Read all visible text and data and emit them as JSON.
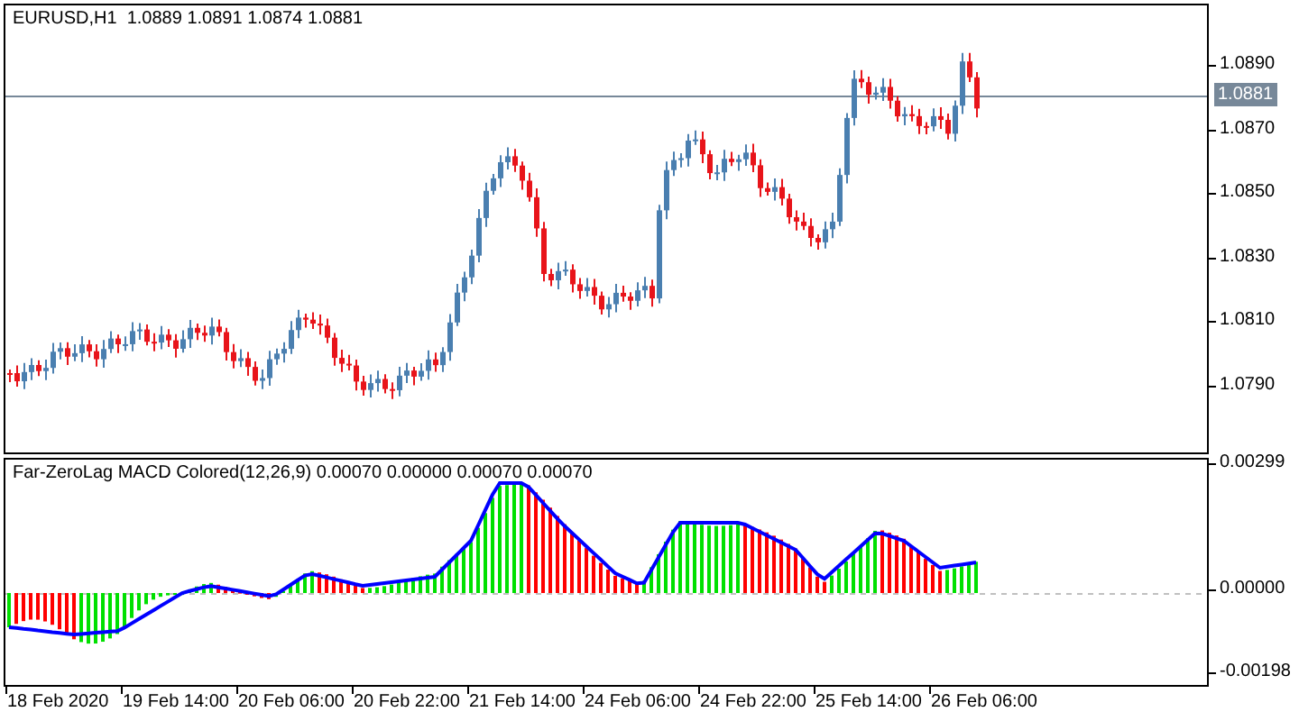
{
  "chart": {
    "symbol_info": "EURUSD,H1  1.0889 1.0891 1.0874 1.0881",
    "price_labels": [
      "1.0890",
      "1.0870",
      "1.0850",
      "1.0830",
      "1.0810",
      "1.0790"
    ],
    "current_price": "1.0881"
  },
  "indicator": {
    "title": "Far-ZeroLag MACD Colored(12,26,9) 0.00070 0.00000 0.00070 0.00070",
    "scale_labels": [
      "0.00299",
      "0.00000",
      "-0.00198"
    ]
  },
  "time_axis": {
    "labels": [
      "18 Feb 2020",
      "19 Feb 14:00",
      "20 Feb 06:00",
      "20 Feb 22:00",
      "21 Feb 14:00",
      "24 Feb 06:00",
      "24 Feb 22:00",
      "25 Feb 14:00",
      "26 Feb 06:00"
    ]
  }
}
